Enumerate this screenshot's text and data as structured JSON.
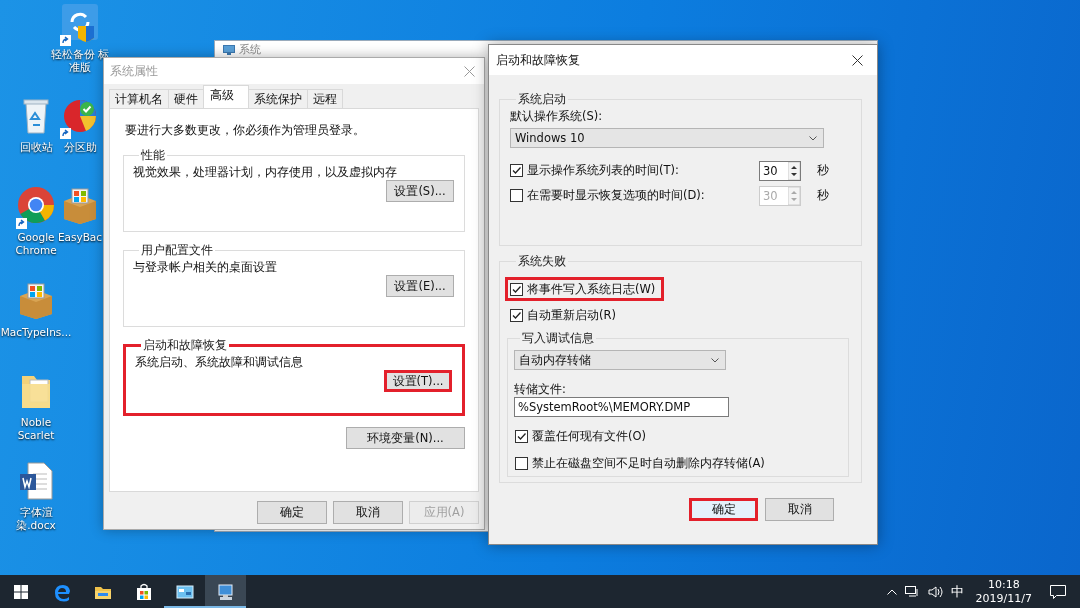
{
  "desktop_icons": [
    {
      "kind": "backup",
      "label": "轻松备份 标准版",
      "shortcut": true
    },
    {
      "kind": "recycle",
      "label": "回收站",
      "shortcut": false
    },
    {
      "kind": "partition",
      "label": "分区助",
      "shortcut": true
    },
    {
      "kind": "chrome",
      "label": "Google Chrome",
      "shortcut": true
    },
    {
      "kind": "box",
      "label": "EasyBac",
      "shortcut": false
    },
    {
      "kind": "box",
      "label": "MacTypeIns...",
      "shortcut": false
    },
    {
      "kind": "folder",
      "label": "Noble Scarlet",
      "shortcut": false
    },
    {
      "kind": "word",
      "label": "字体渲染.docx",
      "shortcut": false
    }
  ],
  "background_window": {
    "title": "系统"
  },
  "system_properties": {
    "title": "系统属性",
    "tabs": [
      {
        "label": "计算机名",
        "selected": false
      },
      {
        "label": "硬件",
        "selected": false
      },
      {
        "label": "高级",
        "selected": true
      },
      {
        "label": "系统保护",
        "selected": false
      },
      {
        "label": "远程",
        "selected": false
      }
    ],
    "notice": "要进行大多数更改，你必须作为管理员登录。",
    "groups": [
      {
        "title": "性能",
        "description": "视觉效果，处理器计划，内存使用，以及虚拟内存",
        "button": "设置(S)...",
        "highlighted": false,
        "button_highlighted": false
      },
      {
        "title": "用户配置文件",
        "description": "与登录帐户相关的桌面设置",
        "button": "设置(E)...",
        "highlighted": false,
        "button_highlighted": false
      },
      {
        "title": "启动和故障恢复",
        "description": "系统启动、系统故障和调试信息",
        "button": "设置(T)...",
        "highlighted": true,
        "button_highlighted": true
      }
    ],
    "env_button": "环境变量(N)...",
    "buttons": [
      {
        "label": "确定",
        "disabled": false
      },
      {
        "label": "取消",
        "disabled": false
      },
      {
        "label": "应用(A)",
        "disabled": true
      }
    ]
  },
  "startup_recovery": {
    "title": "启动和故障恢复",
    "system_startup": {
      "title": "系统启动",
      "default_os_label": "默认操作系统(S):",
      "default_os": "Windows 10",
      "rows": [
        {
          "label": "显示操作系统列表的时间(T):",
          "checked": true,
          "value": "30",
          "disabled": false,
          "unit": "秒"
        },
        {
          "label": "在需要时显示恢复选项的时间(D):",
          "checked": false,
          "value": "30",
          "disabled": true,
          "unit": "秒"
        }
      ]
    },
    "system_failure": {
      "title": "系统失败",
      "options": [
        {
          "label": "将事件写入系统日志(W)",
          "checked": true,
          "highlighted": true
        },
        {
          "label": "自动重新启动(R)",
          "checked": true,
          "highlighted": false
        }
      ],
      "debug": {
        "title": "写入调试信息",
        "type": "自动内存转储",
        "dump_file_label": "转储文件:",
        "dump_file": "%SystemRoot%\\MEMORY.DMP",
        "options": [
          {
            "label": "覆盖任何现有文件(O)",
            "checked": true
          },
          {
            "label": "禁止在磁盘空间不足时自动删除内存转储(A)",
            "checked": false
          }
        ]
      }
    },
    "buttons": [
      {
        "label": "确定",
        "highlighted": true
      },
      {
        "label": "取消",
        "highlighted": false
      }
    ]
  },
  "taskbar": {
    "apps": [
      {
        "kind": "start",
        "selected": false,
        "running": false
      },
      {
        "kind": "edge",
        "selected": false,
        "running": false
      },
      {
        "kind": "explorer",
        "selected": false,
        "running": false
      },
      {
        "kind": "store",
        "selected": false,
        "running": false
      },
      {
        "kind": "control",
        "selected": false,
        "running": true
      },
      {
        "kind": "system",
        "selected": true,
        "running": true
      }
    ],
    "input_method": "中",
    "time": "10:18",
    "date": "2019/11/7"
  }
}
